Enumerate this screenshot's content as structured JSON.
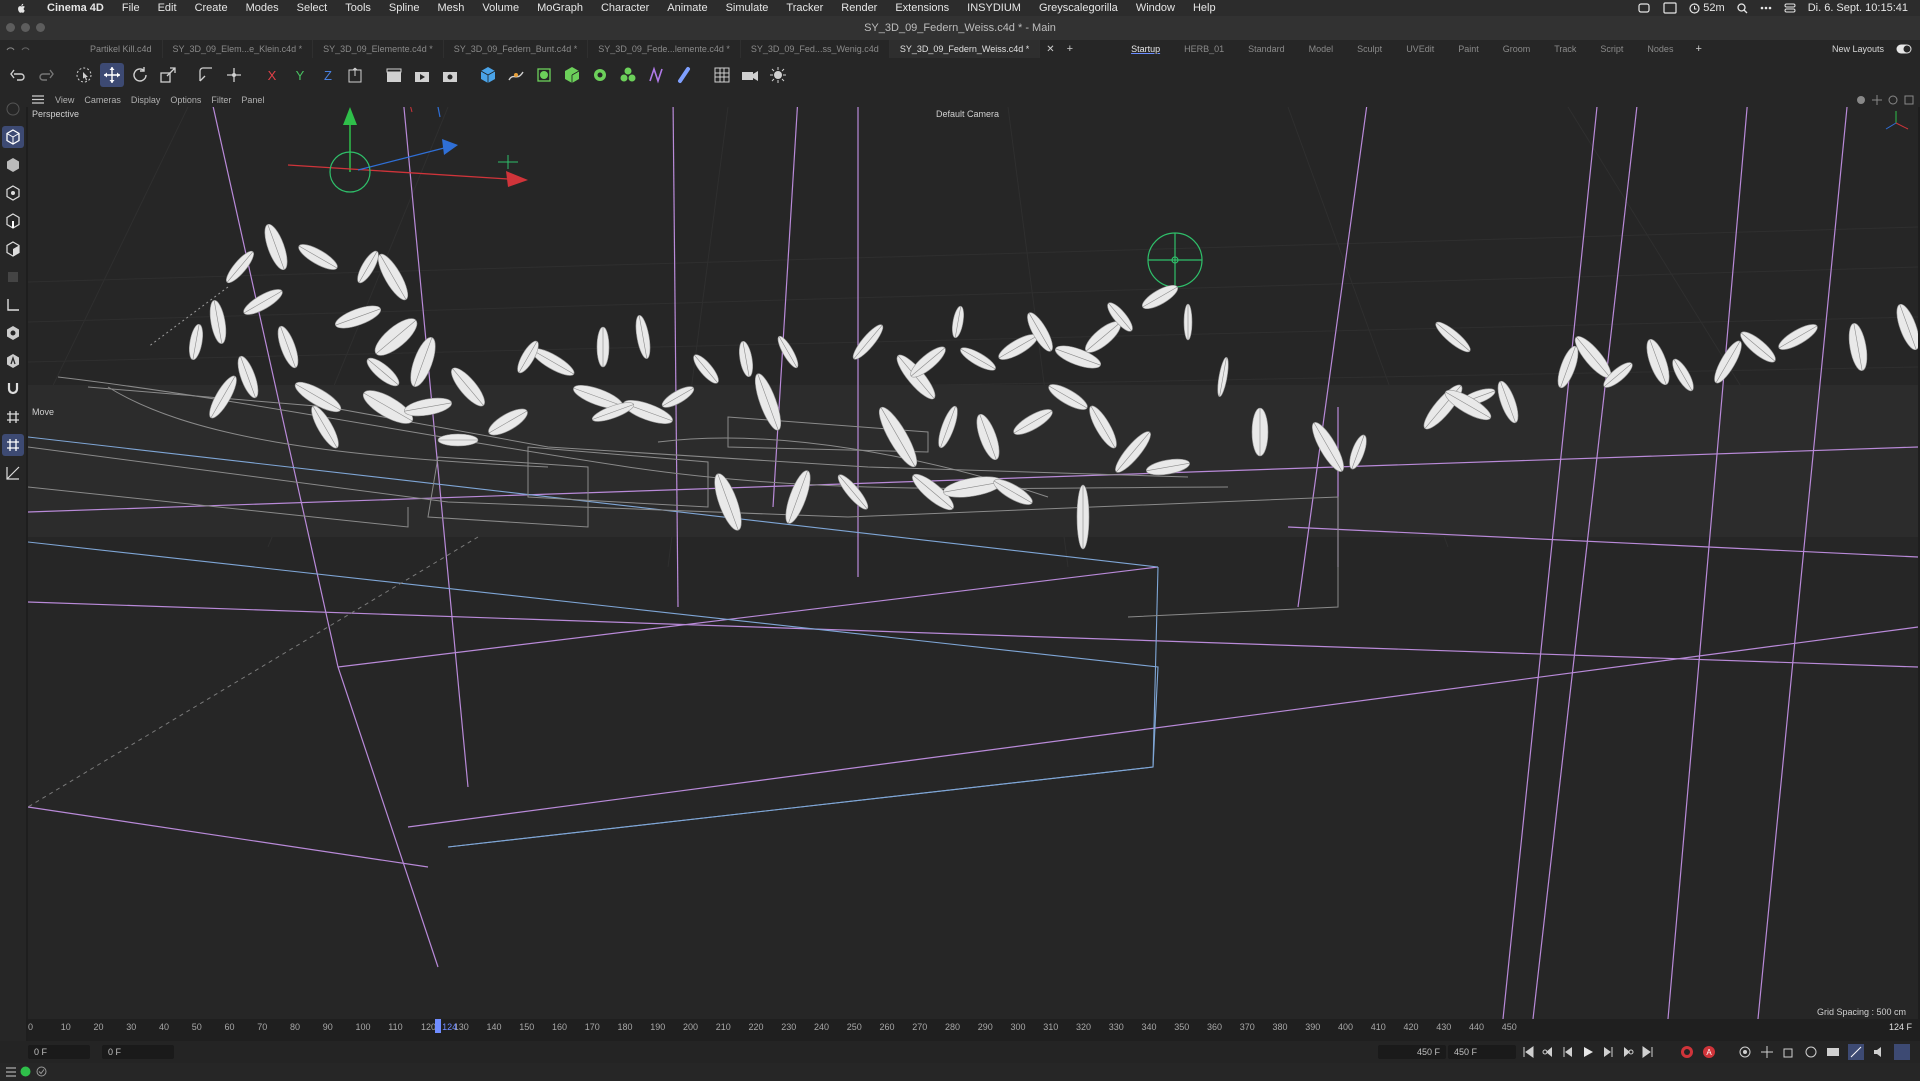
{
  "menubar": {
    "app": "Cinema 4D",
    "items": [
      "File",
      "Edit",
      "Create",
      "Modes",
      "Select",
      "Tools",
      "Spline",
      "Mesh",
      "Volume",
      "MoGraph",
      "Character",
      "Animate",
      "Simulate",
      "Tracker",
      "Render",
      "Extensions",
      "INSYDIUM",
      "Greyscalegorilla",
      "Window",
      "Help"
    ],
    "battery_time": "52m",
    "datetime": "Di. 6. Sept.  10:15:41"
  },
  "window": {
    "title": "SY_3D_09_Federn_Weiss.c4d * - Main"
  },
  "doc_tabs": [
    {
      "label": "Partikel Kill.c4d",
      "active": false
    },
    {
      "label": "SY_3D_09_Elem...e_Klein.c4d *",
      "active": false
    },
    {
      "label": "SY_3D_09_Elemente.c4d *",
      "active": false
    },
    {
      "label": "SY_3D_09_Federn_Bunt.c4d *",
      "active": false
    },
    {
      "label": "SY_3D_09_Fede...lemente.c4d *",
      "active": false
    },
    {
      "label": "SY_3D_09_Fed...ss_Wenig.c4d",
      "active": false
    },
    {
      "label": "SY_3D_09_Federn_Weiss.c4d *",
      "active": true
    }
  ],
  "layouts": [
    "Startup",
    "HERB_01",
    "Standard",
    "Model",
    "Sculpt",
    "UVEdit",
    "Paint",
    "Groom",
    "Track",
    "Script",
    "Nodes"
  ],
  "active_layout": "Startup",
  "new_layouts_label": "New Layouts",
  "axis_labels": {
    "x": "X",
    "y": "Y",
    "z": "Z"
  },
  "view_menu": [
    "View",
    "Cameras",
    "Display",
    "Options",
    "Filter",
    "Panel"
  ],
  "viewport": {
    "name": "Perspective",
    "camera": "Default Camera",
    "tool": "Move",
    "grid_spacing": "Grid Spacing : 500 cm"
  },
  "timeline": {
    "ticks": [
      "0",
      "10",
      "20",
      "30",
      "40",
      "50",
      "60",
      "70",
      "80",
      "90",
      "100",
      "110",
      "120",
      "130",
      "140",
      "150",
      "160",
      "170",
      "180",
      "190",
      "200",
      "210",
      "220",
      "230",
      "240",
      "250",
      "260",
      "270",
      "280",
      "290",
      "300",
      "310",
      "320",
      "330",
      "340",
      "350",
      "360",
      "370",
      "380",
      "390",
      "400",
      "410",
      "420",
      "430",
      "440",
      "450"
    ],
    "current_frame_label": "124",
    "current_frame": 124,
    "end_frame_display": "124 F"
  },
  "transport": {
    "start_field": "0 F",
    "start_field2": "0 F",
    "end_field": "450 F",
    "end_field2": "450 F"
  },
  "colors": {
    "accent": "#3d4a73",
    "x_axis": "#d0343a",
    "y_axis": "#2fbf4a",
    "z_axis": "#2f6fd6",
    "spline_magenta": "#b98ad9",
    "spline_blue": "#7fa6d6",
    "null_green": "#2fbf6a"
  }
}
